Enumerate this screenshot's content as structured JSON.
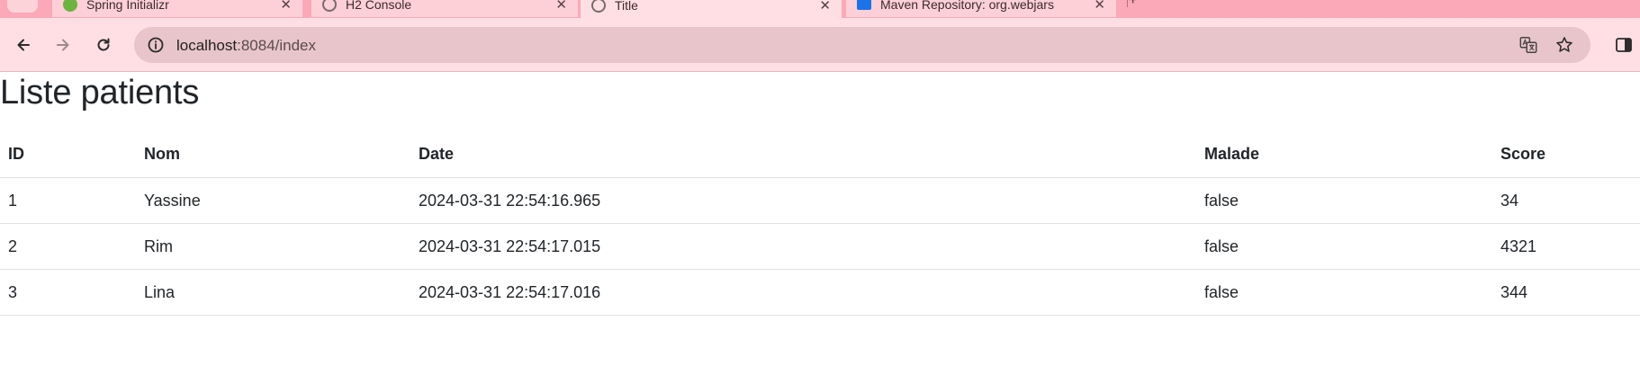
{
  "browser": {
    "tabs": [
      {
        "title": "Spring Initializr",
        "favicon": "spring-icon",
        "color": "#6db33f"
      },
      {
        "title": "H2 Console",
        "favicon": "globe-icon",
        "color": "#7a6a6d"
      },
      {
        "title": "Title",
        "favicon": "globe-icon",
        "color": "#7a6a6d"
      },
      {
        "title": "Maven Repository: org.webjars",
        "favicon": "maven-icon",
        "color": "#1a73e8"
      }
    ],
    "url_host": "localhost",
    "url_path": ":8084/index"
  },
  "page": {
    "title": "Liste patients",
    "table": {
      "headers": [
        "ID",
        "Nom",
        "Date",
        "Malade",
        "Score"
      ],
      "rows": [
        [
          "1",
          "Yassine",
          "2024-03-31 22:54:16.965",
          "false",
          "34"
        ],
        [
          "2",
          "Rim",
          "2024-03-31 22:54:17.015",
          "false",
          "4321"
        ],
        [
          "3",
          "Lina",
          "2024-03-31 22:54:17.016",
          "false",
          "344"
        ]
      ]
    }
  },
  "colors": {
    "tabstrip": "#fba9b8",
    "toolbar": "#ffdfe4",
    "omnibox": "#e8c5ca"
  }
}
